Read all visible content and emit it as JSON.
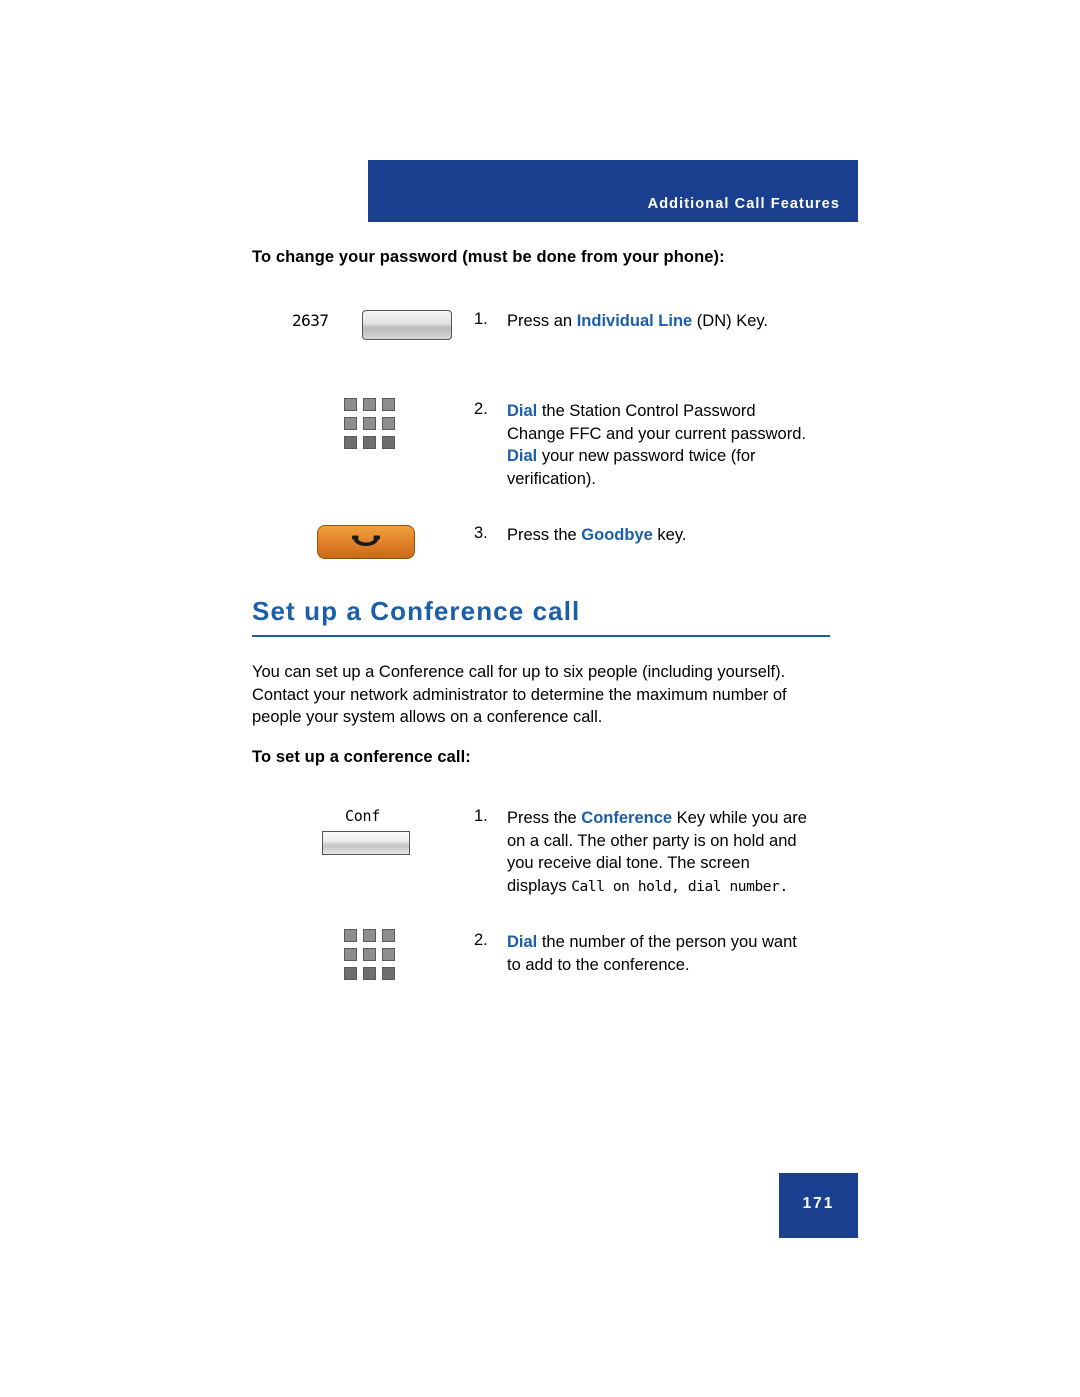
{
  "header": {
    "banner_text": "Additional Call Features"
  },
  "password_section": {
    "heading": "To change your password (must be done from your phone):",
    "dn_key_label": "2637",
    "steps": [
      {
        "number": "1.",
        "pre": "Press an ",
        "emphasis": "Individual Line",
        "post": " (DN) Key."
      },
      {
        "number": "2.",
        "line1_emphasis": "Dial",
        "line1_rest": " the Station Control Password",
        "line2": "Change FFC and your current password.",
        "line3_emphasis": "Dial",
        "line3_rest": " your new password twice (for",
        "line4": "verification)."
      },
      {
        "number": "3.",
        "pre": "Press the ",
        "emphasis": "Goodbye",
        "post": " key."
      }
    ]
  },
  "conference_section": {
    "title": "Set up a Conference call",
    "intro_line1": "You can set up a Conference call for up to six people (including yourself).",
    "intro_line2": "Contact your network administrator to determine the maximum number of",
    "intro_line3": "people your system allows on a conference call.",
    "subheading": "To set up a conference call:",
    "conf_key_label": "Conf",
    "steps": [
      {
        "number": "1.",
        "pre": "Press the ",
        "emphasis": "Conference",
        "post": " Key while you are",
        "line2": "on a call. The other party is on hold and",
        "line3": "you receive dial tone. The screen",
        "line4_pre": "displays ",
        "line4_mono": "Call on hold, dial number."
      },
      {
        "number": "2.",
        "emphasis": "Dial",
        "rest": " the number of the person you want",
        "line2": "to add to the conference."
      }
    ]
  },
  "footer": {
    "page_number": "171"
  },
  "colors": {
    "banner_blue": "#1b3f8f",
    "accent_blue": "#1b5fa8",
    "goodbye_orange": "#e2822a"
  }
}
